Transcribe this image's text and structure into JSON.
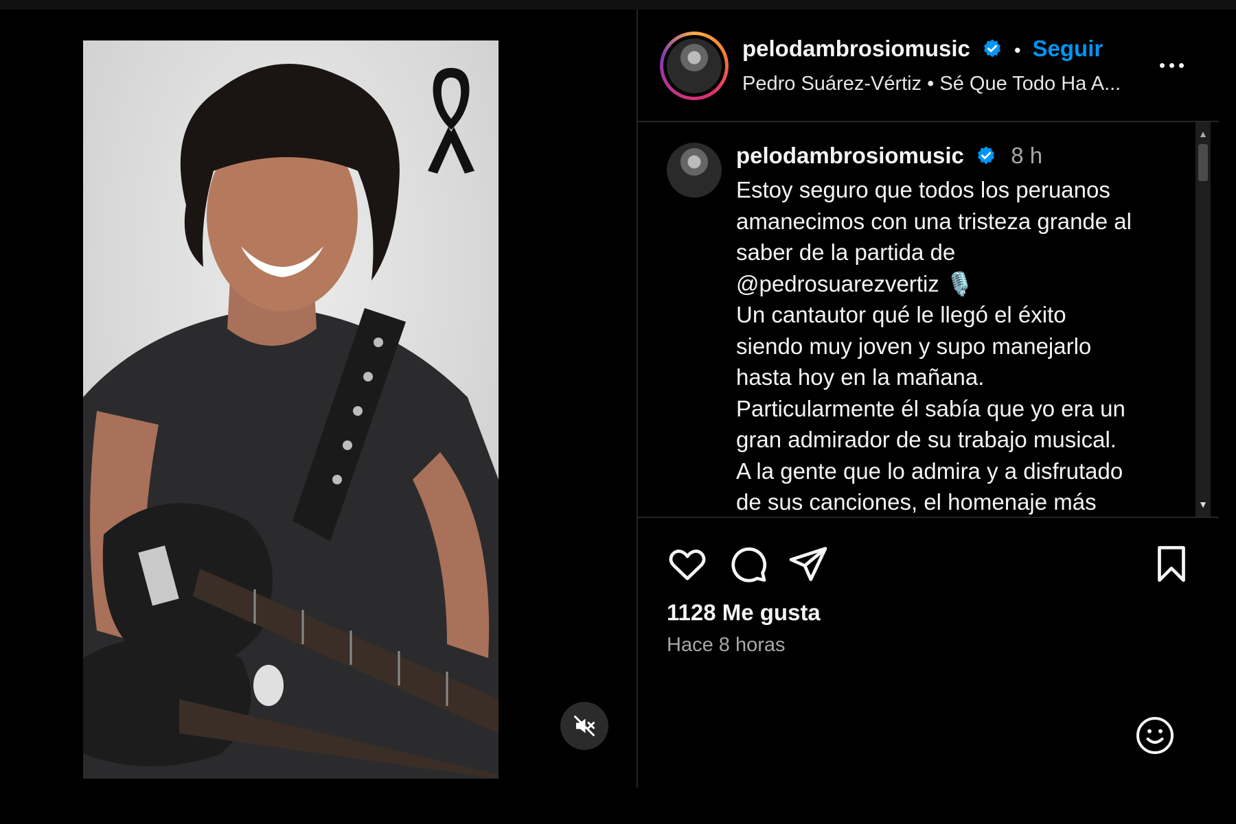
{
  "header": {
    "username": "pelodambrosiomusic",
    "separator": "•",
    "follow_label": "Seguir",
    "subtitle": "Pedro Suárez-Vértiz • Sé Que Todo Ha A..."
  },
  "comment": {
    "username": "pelodambrosiomusic",
    "time": "8 h",
    "lines": [
      "Estoy seguro que todos los peruanos",
      "amanecimos con una tristeza grande al",
      "saber de la partida de",
      "@pedrosuarezvertiz 🎙️",
      "Un cantautor qué le llegó el éxito",
      "siendo muy joven y supo manejarlo",
      "hasta hoy en la mañana.",
      "Particularmente él sabía que yo era un",
      "gran admirador de su trabajo musical.",
      "A la gente que lo admira y a disfrutado",
      "de sus canciones, el homenaje más"
    ]
  },
  "stats": {
    "likes": "1128 Me gusta",
    "posted": "Hace 8 horas"
  },
  "icons": {
    "verified": "verified-badge-icon",
    "mute": "speaker-muted-icon",
    "like": "heart-icon",
    "comment": "comment-bubble-icon",
    "share": "paper-plane-icon",
    "save": "bookmark-icon",
    "emoji": "smiley-icon",
    "mourning": "black-ribbon-icon"
  },
  "colors": {
    "accent": "#0095f6",
    "background": "#000000",
    "muted_text": "#a8a8a8"
  }
}
